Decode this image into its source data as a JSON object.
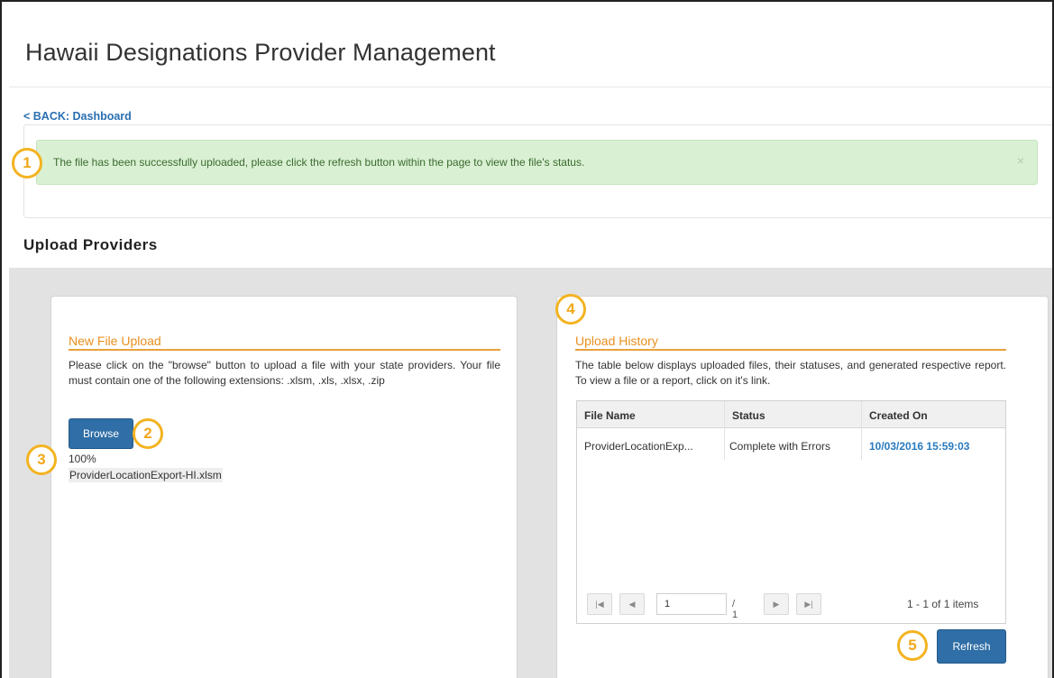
{
  "header": {
    "title": "Hawaii Designations Provider Management"
  },
  "nav": {
    "back_label": "< BACK: Dashboard"
  },
  "alert": {
    "message": "The file has been successfully uploaded, please click the refresh button within the page to view the file's status.",
    "close_glyph": "×"
  },
  "section": {
    "heading": "Upload Providers"
  },
  "new_upload": {
    "title": "New File Upload",
    "description": "Please click on the \"browse\" button to upload a file with your state providers. Your file must contain one of the following extensions: .xlsm, .xls, .xlsx, .zip",
    "browse_label": "Browse",
    "progress_text": "100%",
    "progress_fraction": 1.0,
    "file_name": "ProviderLocationExport-HI.xlsm"
  },
  "history": {
    "title": "Upload History",
    "description": "The table below displays uploaded files, their statuses, and generated respective report. To view a file or a report, click on it's link.",
    "columns": [
      "File Name",
      "Status",
      "Created On"
    ],
    "rows": [
      {
        "file_name": "ProviderLocationExp...",
        "status": "Complete with Errors",
        "created_on": "10/03/2016 15:59:03"
      }
    ],
    "pager": {
      "first_icon": "first-page-icon",
      "prev_icon": "prev-page-icon",
      "next_icon": "next-page-icon",
      "last_icon": "last-page-icon",
      "first_glyph": "|◀",
      "prev_glyph": "◀",
      "next_glyph": "▶",
      "last_glyph": "▶|",
      "page_value": "1",
      "of_text": "/ 1",
      "items_text": "1 - 1 of 1 items"
    },
    "refresh_label": "Refresh"
  },
  "callouts": [
    "1",
    "2",
    "3",
    "4",
    "5"
  ],
  "colors": {
    "accent_orange": "#e8901e",
    "callout_ring": "#f3b321",
    "button_blue": "#2f6ea6",
    "link_blue": "#2a6fb0",
    "success_bg": "#d9f0d3"
  }
}
